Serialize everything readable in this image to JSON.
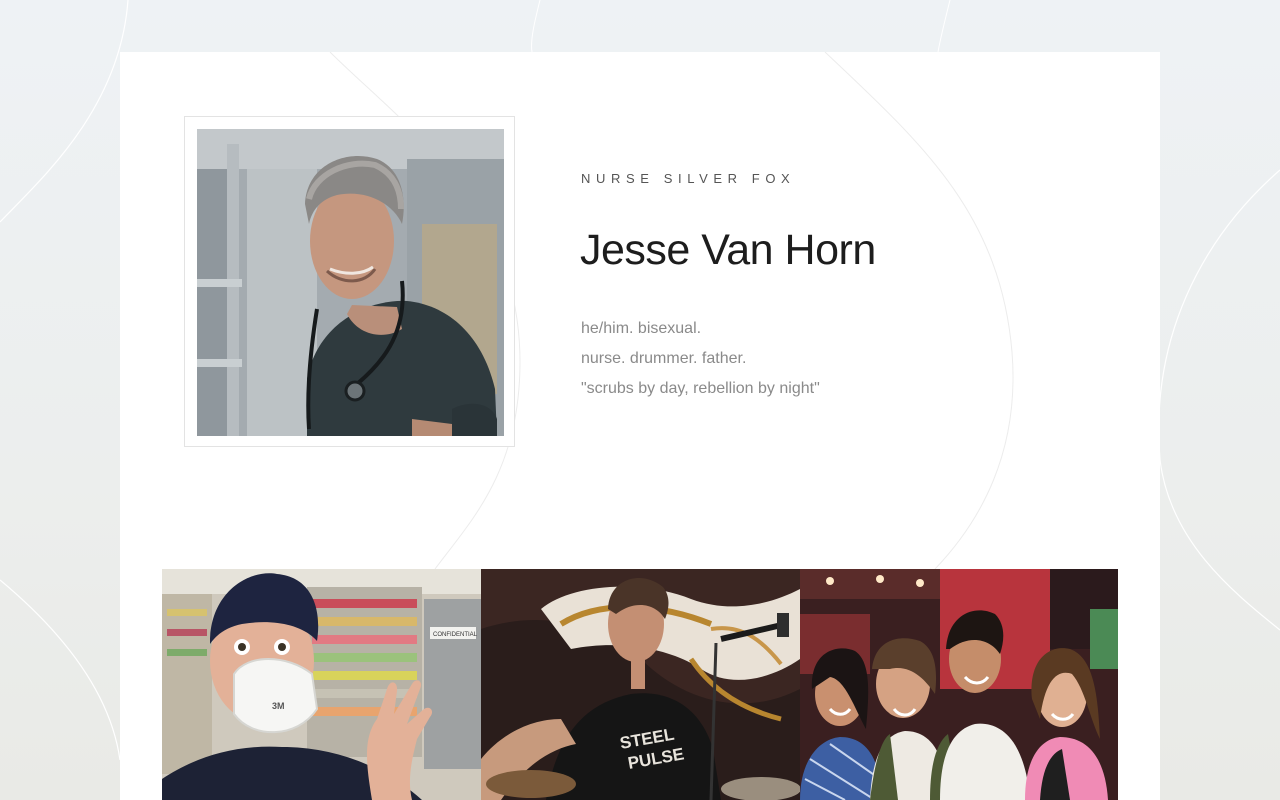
{
  "profile": {
    "eyebrow": "NURSE SILVER FOX",
    "name": "Jesse Van Horn",
    "bio_lines": [
      "he/him. bisexual.",
      "nurse. drummer. father.",
      "\"scrubs by day, rebellion by night\""
    ]
  },
  "gallery": {
    "photos": [
      {
        "subject": "selfie in surgical cap and 3M mask making rock hand sign",
        "mask_text": "3M",
        "cabinet_label": "CONFIDENTIAL"
      },
      {
        "subject": "drummer performing on stage in Steel Pulse shirt",
        "shirt_text": "STEEL PULSE"
      },
      {
        "subject": "group of four friends smiling at an arcade"
      }
    ]
  },
  "colors": {
    "page_bg": "#eef2f5",
    "card_bg": "#ffffff",
    "name_text": "#1d1d1d",
    "bio_text": "#8a8a8a",
    "eyebrow_text": "#555555"
  }
}
